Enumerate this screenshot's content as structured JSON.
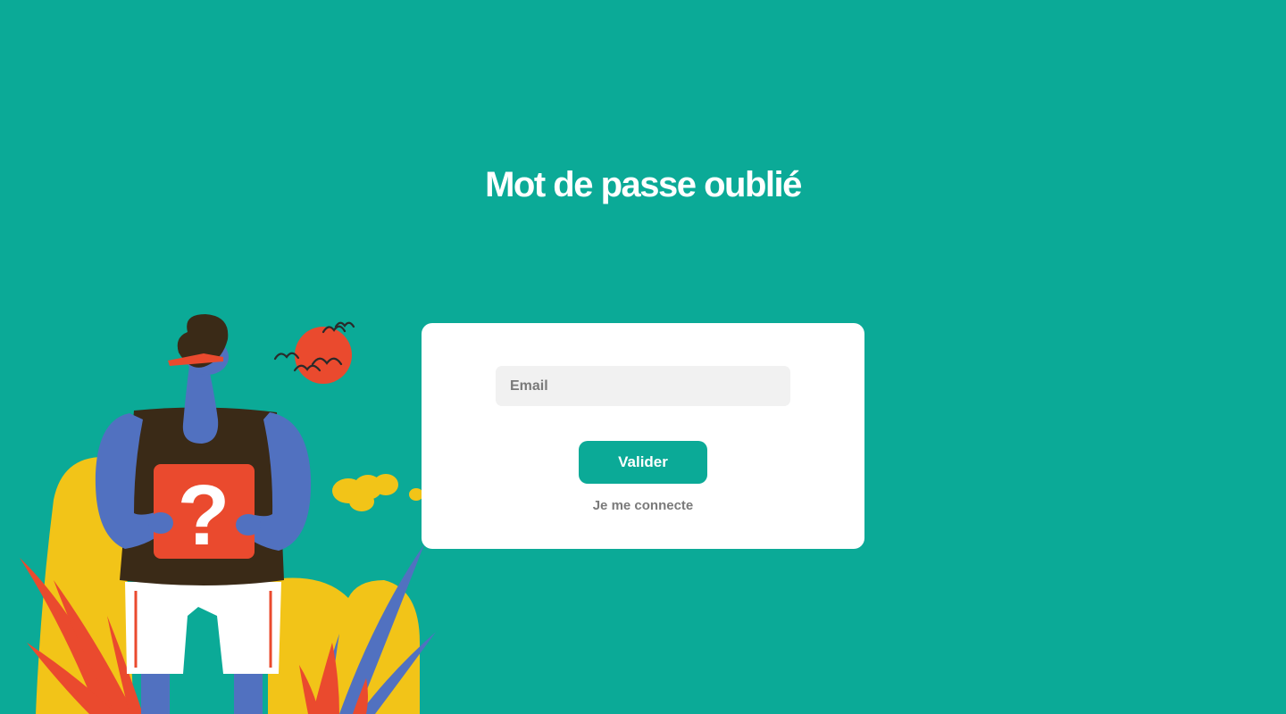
{
  "header": {
    "title": "Mot de passe oublié"
  },
  "form": {
    "email_placeholder": "Email",
    "email_value": "",
    "submit_label": "Valider",
    "login_link_label": "Je me connecte"
  },
  "illustration": {
    "icon": "question-mark-icon",
    "symbol": "?"
  },
  "colors": {
    "background": "#0baa97",
    "card": "#ffffff",
    "input_bg": "#f1f1f1",
    "button": "#0baa97",
    "link": "#7a7a7a",
    "figure_skin": "#5171c0",
    "figure_shirt": "#3a2a17",
    "figure_sign": "#ea4a2e",
    "plant_yellow": "#f2c418",
    "plant_red": "#ea4a2e"
  }
}
